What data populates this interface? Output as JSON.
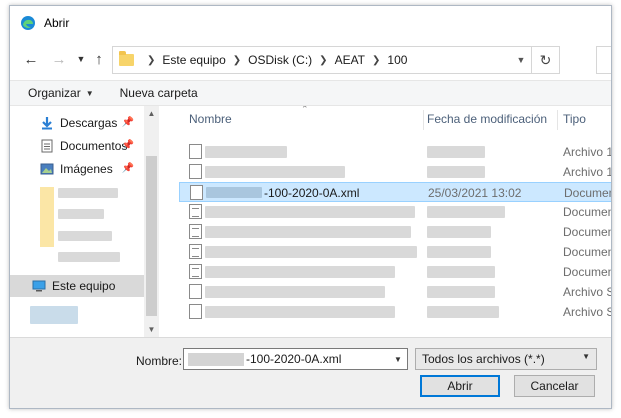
{
  "window": {
    "title": "Abrir"
  },
  "address": {
    "segments": [
      "Este equipo",
      "OSDisk (C:)",
      "AEAT",
      "100"
    ]
  },
  "toolbar": {
    "organize_label": "Organizar",
    "new_folder_label": "Nueva carpeta"
  },
  "sidebar": {
    "items": [
      {
        "label": "Descargas",
        "icon": "download-icon",
        "pinned": true
      },
      {
        "label": "Documentos",
        "icon": "documents-icon",
        "pinned": true
      },
      {
        "label": "Imágenes",
        "icon": "pictures-icon",
        "pinned": true
      },
      {
        "label": "Este equipo",
        "icon": "computer-icon",
        "selected": true
      }
    ]
  },
  "columns": {
    "name": "Nombre",
    "date": "Fecha de modificación",
    "type": "Tipo"
  },
  "files": [
    {
      "name": "",
      "date": "",
      "type": "Archivo 1"
    },
    {
      "name": "",
      "date": "",
      "type": "Archivo 1"
    },
    {
      "name": "-100-2020-0A.xml",
      "date": "25/03/2021 13:02",
      "type": "Documen",
      "selected": true
    },
    {
      "name": "",
      "date": "",
      "type": "Documen"
    },
    {
      "name": "",
      "date": "",
      "type": "Documen"
    },
    {
      "name": "",
      "date": "",
      "type": "Documen"
    },
    {
      "name": "",
      "date": "",
      "type": "Documen"
    },
    {
      "name": "",
      "date": "",
      "type": "Archivo S"
    },
    {
      "name": "",
      "date": "",
      "type": "Archivo S"
    }
  ],
  "bottom": {
    "name_label": "Nombre:",
    "filename_value": "-100-2020-0A.xml",
    "filter_value": "Todos los archivos (*.*)",
    "open_label": "Abrir",
    "cancel_label": "Cancelar"
  },
  "colors": {
    "accent": "#0078d7",
    "selection": "#cce8ff",
    "header_text": "#4c607a"
  }
}
